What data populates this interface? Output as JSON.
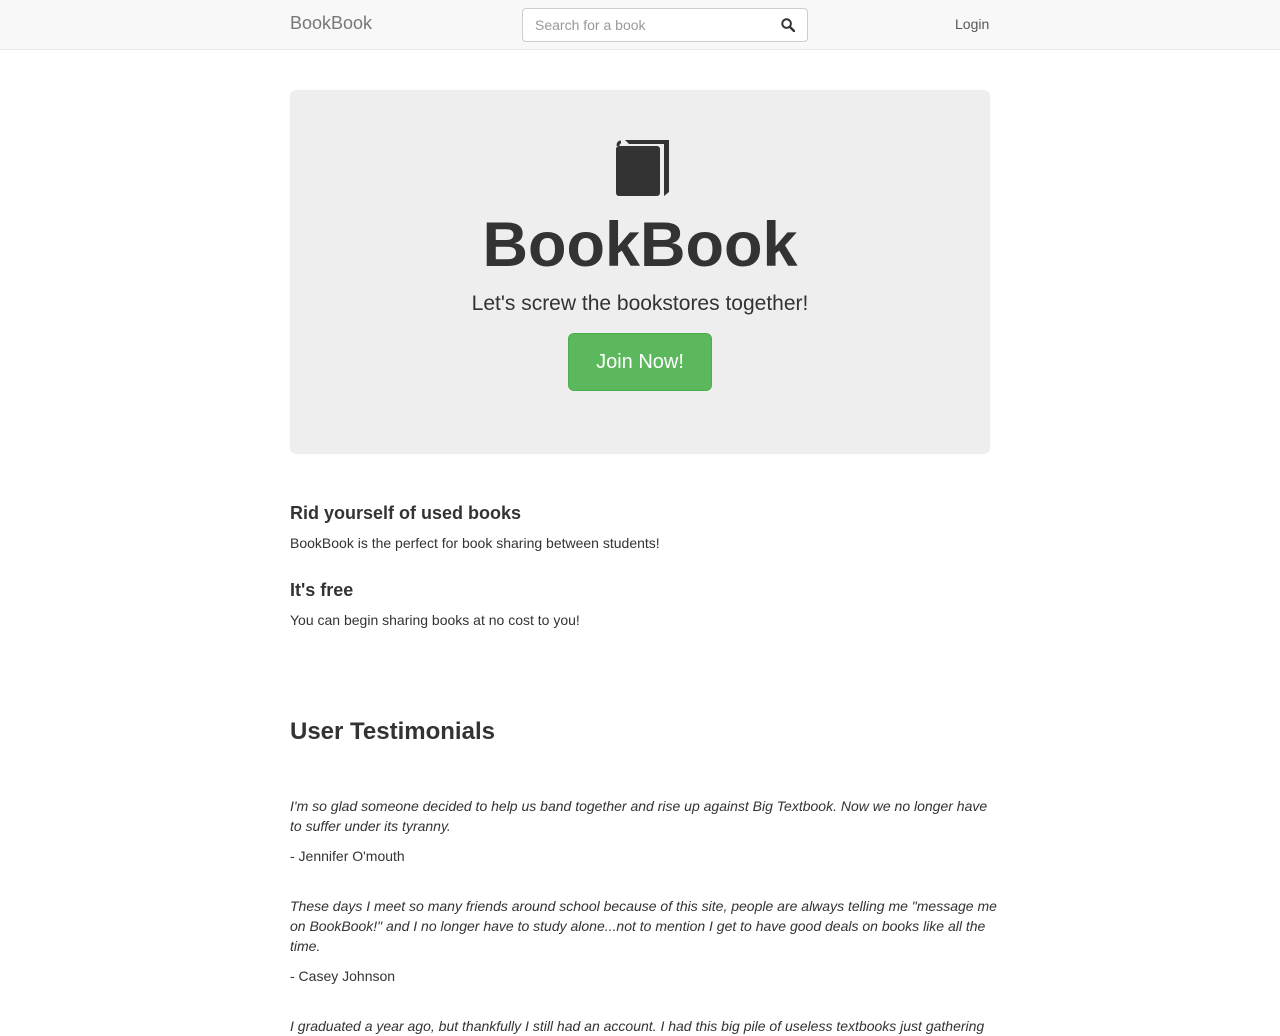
{
  "navbar": {
    "brand": "BookBook",
    "search_placeholder": "Search for a book",
    "search_icon": "search-icon",
    "login": "Login"
  },
  "hero": {
    "icon": "book-icon",
    "title": "BookBook",
    "subtitle": "Let's screw the bookstores together!",
    "cta": "Join Now!"
  },
  "features": [
    {
      "title": "Rid yourself of used books",
      "text": "BookBook is the perfect for book sharing between students!"
    },
    {
      "title": "It's free",
      "text": "You can begin sharing books at no cost to you!"
    }
  ],
  "testimonials": {
    "title": "User Testimonials",
    "items": [
      {
        "quote": "I'm so glad someone decided to help us band together and rise up against Big Textbook. Now we no longer have to suffer under its tyranny.",
        "author": "- Jennifer O'mouth"
      },
      {
        "quote": "These days I meet so many friends around school because of this site, people are always telling me \"message me on BookBook!\" and I no longer have to study alone...not to mention I get to have good deals on books like all the time.",
        "author": "- Casey Johnson"
      },
      {
        "quote": "I graduated a year ago, but thankfully I still had an account. I had this big pile of useless textbooks just gathering",
        "author": ""
      }
    ]
  },
  "colors": {
    "navbar_bg": "#f8f8f8",
    "jumbotron_bg": "#eeeeee",
    "cta_green": "#5cb85c",
    "text": "#333333"
  }
}
